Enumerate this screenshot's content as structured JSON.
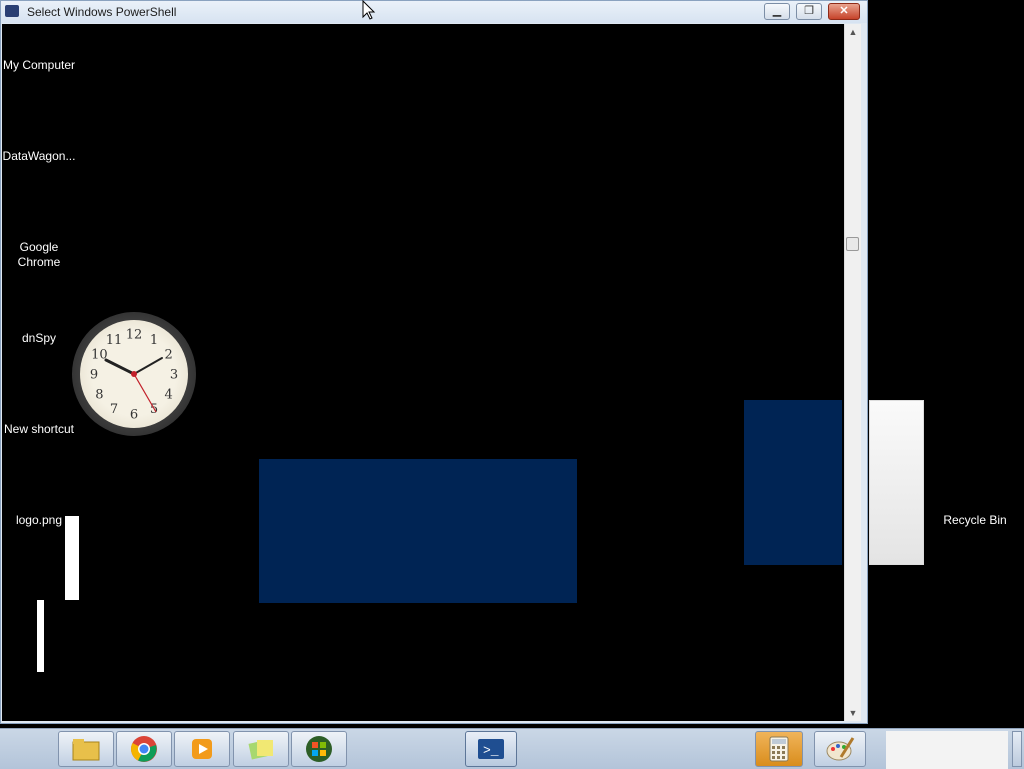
{
  "window": {
    "title": "Select Windows PowerShell",
    "minimize_label": "▁",
    "restore_label": "❐",
    "close_label": "✕"
  },
  "desktop_icons": [
    {
      "label": "My Computer"
    },
    {
      "label": "DataWagon..."
    },
    {
      "label": "Google Chrome"
    },
    {
      "label": "dnSpy"
    },
    {
      "label": "New shortcut"
    },
    {
      "label": "logo.png"
    },
    {
      "label": "Recycle Bin"
    }
  ],
  "clock": {
    "numbers": [
      "12",
      "1",
      "2",
      "3",
      "4",
      "5",
      "6",
      "7",
      "8",
      "9",
      "10",
      "11"
    ]
  },
  "taskbar": {
    "items": [
      {
        "icon": "file-explorer-icon"
      },
      {
        "icon": "chrome-icon"
      },
      {
        "icon": "media-player-icon"
      },
      {
        "icon": "sticky-notes-icon"
      },
      {
        "icon": "windows-logo-icon"
      },
      {
        "icon": "powershell-icon"
      },
      {
        "icon": "calculator-icon"
      },
      {
        "icon": "paint-icon"
      }
    ]
  },
  "colors": {
    "console_bg": "#000000",
    "block_blue": "#002454",
    "taskbar": "#b9c9dc"
  }
}
